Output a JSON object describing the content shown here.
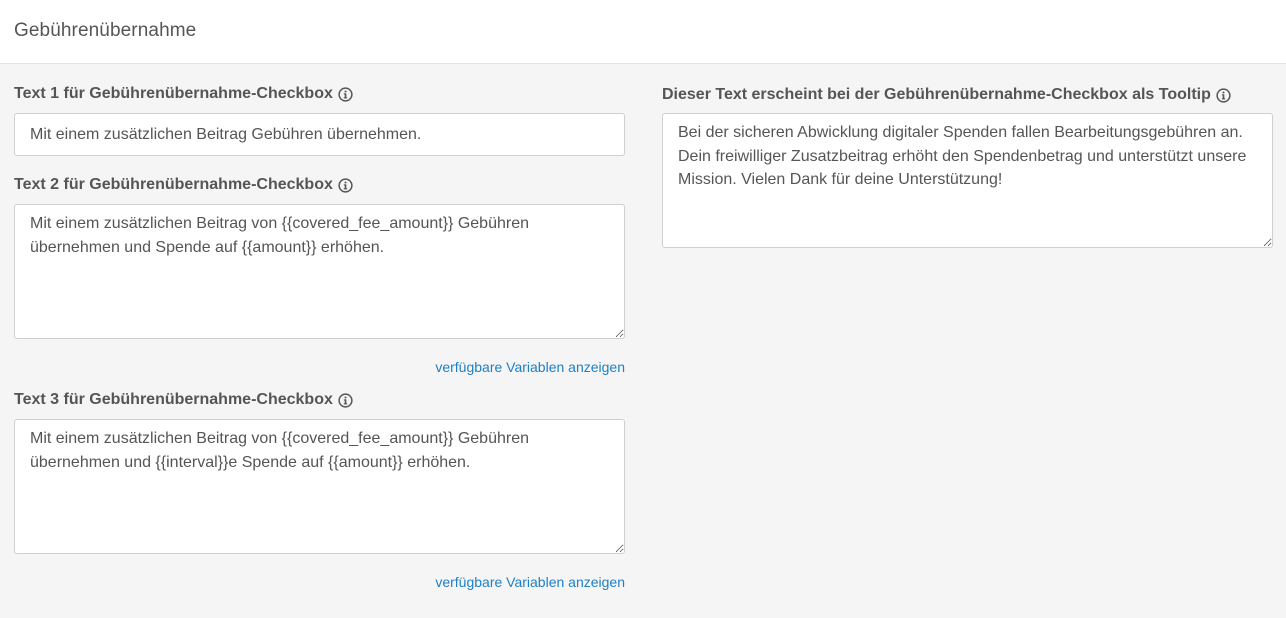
{
  "header": {
    "title": "Gebührenübernahme"
  },
  "fields": {
    "text1": {
      "label": "Text 1 für Gebührenübernahme-Checkbox",
      "value": "Mit einem zusätzlichen Beitrag Gebühren übernehmen."
    },
    "text2": {
      "label": "Text 2 für Gebührenübernahme-Checkbox",
      "value": "Mit einem zusätzlichen Beitrag von {{covered_fee_amount}} Gebühren übernehmen und Spende auf {{amount}} erhöhen.",
      "link": "verfügbare Variablen anzeigen"
    },
    "text3": {
      "label": "Text 3 für Gebührenübernahme-Checkbox",
      "value": "Mit einem zusätzlichen Beitrag von {{covered_fee_amount}} Gebühren übernehmen und {{interval}}e Spende auf {{amount}} erhöhen.",
      "link": "verfügbare Variablen anzeigen"
    },
    "tooltip": {
      "label": "Dieser Text erscheint bei der Gebührenübernahme-Checkbox als Tooltip",
      "value": "Bei der sicheren Abwicklung digitaler Spenden fallen Bearbeitungsgebühren an. Dein freiwilliger Zusatzbeitrag erhöht den Spendenbetrag und unterstützt unsere Mission. Vielen Dank für deine Unterstützung!"
    }
  },
  "icons": {
    "info": "info-icon"
  },
  "colors": {
    "link": "#1e80c8",
    "text": "#555555",
    "border": "#cfcfcf"
  }
}
